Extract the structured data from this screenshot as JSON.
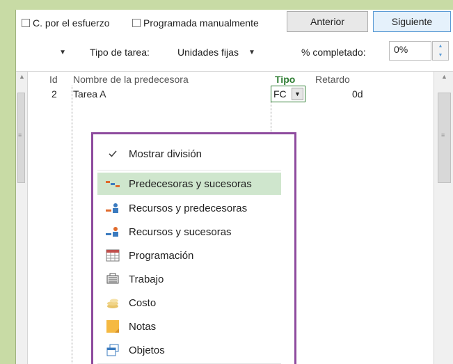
{
  "toolbar": {
    "effort_label": "C. por el esfuerzo",
    "manual_label": "Programada manualmente",
    "prev_button": "Anterior",
    "next_button": "Siguiente"
  },
  "row2": {
    "task_type_label": "Tipo de tarea:",
    "task_type_value": "Unidades fijas",
    "pct_label": "% completado:",
    "pct_value": "0%"
  },
  "grid": {
    "headers": {
      "id": "Id",
      "name": "Nombre de la predecesora",
      "type": "Tipo",
      "lag": "Retardo"
    },
    "rows": [
      {
        "id": "2",
        "name": "Tarea A",
        "type": "FC",
        "lag": "0d"
      }
    ]
  },
  "menu": {
    "items": [
      {
        "label": "Mostrar división",
        "icon": "check-icon"
      },
      {
        "label": "Predecesoras y sucesoras",
        "icon": "predecessors-successors-icon",
        "active": true
      },
      {
        "label": "Recursos y predecesoras",
        "icon": "resources-predecessors-icon"
      },
      {
        "label": "Recursos y sucesoras",
        "icon": "resources-successors-icon"
      },
      {
        "label": "Programación",
        "icon": "calendar-grid-icon"
      },
      {
        "label": "Trabajo",
        "icon": "work-icon"
      },
      {
        "label": "Costo",
        "icon": "cost-coins-icon"
      },
      {
        "label": "Notas",
        "icon": "notes-icon"
      },
      {
        "label": "Objetos",
        "icon": "objects-icon"
      }
    ]
  },
  "colors": {
    "background": "#c8dba5",
    "menu_border": "#8e4b9e",
    "menu_highlight": "#cfe6cd",
    "primary_button_border": "#5b9bd5"
  }
}
